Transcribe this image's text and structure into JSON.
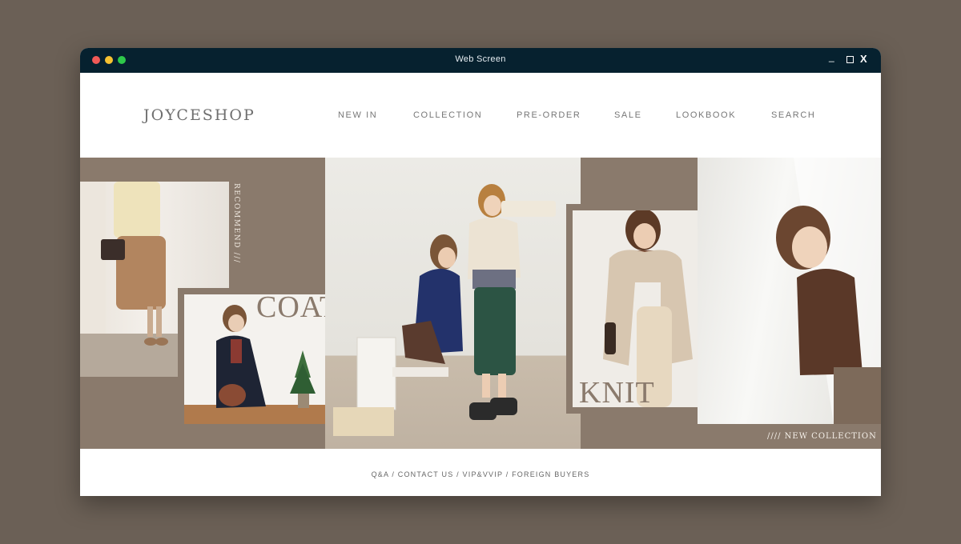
{
  "window": {
    "title": "Web Screen",
    "controls": {
      "minimize": "_",
      "maximize": "",
      "close": "X"
    }
  },
  "header": {
    "logo": "JOYCESHOP",
    "nav": [
      "NEW IN",
      "COLLECTION",
      "PRE-ORDER",
      "SALE",
      "LOOKBOOK",
      "SEARCH"
    ]
  },
  "hero": {
    "recommend_label": "RECOMMEND ///",
    "coat_label": "COAT",
    "knit_label": "KNIT",
    "new_collection_label": "//// NEW COLLECTION"
  },
  "footer": {
    "links": "Q&A / CONTACT US / VIP&VVIP / FOREIGN BUYERS"
  },
  "colors": {
    "page_bg": "#6b6056",
    "titlebar": "#06212f",
    "brand_taupe": "#8a7a6c",
    "text_gray": "#777777"
  }
}
